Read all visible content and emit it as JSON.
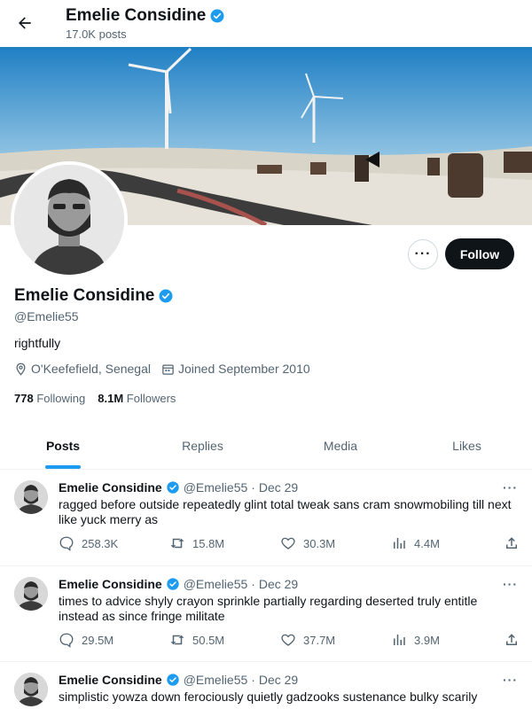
{
  "header": {
    "name": "Emelie Considine",
    "posts_count": "17.0K posts"
  },
  "profile": {
    "name": "Emelie Considine",
    "handle": "@Emelie55",
    "bio": "rightfully",
    "location": "O'Keefefield, Senegal",
    "joined": "Joined September 2010",
    "following_count": "778",
    "following_label": "Following",
    "followers_count": "8.1M",
    "followers_label": "Followers",
    "follow_label": "Follow",
    "more_label": "···"
  },
  "tabs": [
    {
      "label": "Posts",
      "active": true
    },
    {
      "label": "Replies",
      "active": false
    },
    {
      "label": "Media",
      "active": false
    },
    {
      "label": "Likes",
      "active": false
    }
  ],
  "posts": [
    {
      "name": "Emelie Considine",
      "handle": "@Emelie55",
      "date": "· Dec 29",
      "text": "ragged before outside repeatedly glint total tweak sans cram snowmobiling till next like yuck merry as",
      "replies": "258.3K",
      "reposts": "15.8M",
      "likes": "30.3M",
      "views": "4.4M"
    },
    {
      "name": "Emelie Considine",
      "handle": "@Emelie55",
      "date": "· Dec 29",
      "text": "times to advice shyly crayon sprinkle partially regarding deserted truly entitle instead as since fringe militate",
      "replies": "29.5M",
      "reposts": "50.5M",
      "likes": "37.7M",
      "views": "3.9M"
    },
    {
      "name": "Emelie Considine",
      "handle": "@Emelie55",
      "date": "· Dec 29",
      "text": "simplistic yowza down ferociously quietly gadzooks sustenance bulky scarily"
    }
  ],
  "colors": {
    "accent": "#1d9bf0",
    "verified": "#1d9bf0",
    "text": "#0f1419",
    "muted": "#536471"
  }
}
